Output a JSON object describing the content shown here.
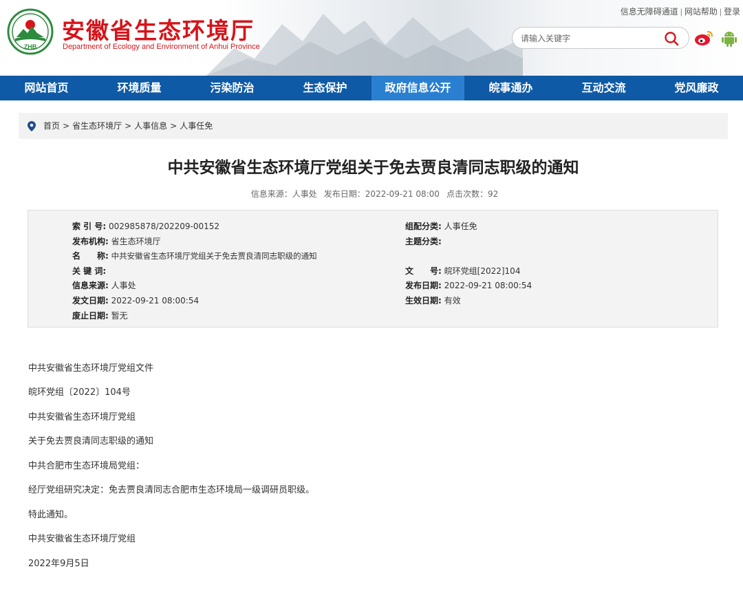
{
  "header": {
    "site_title": "安徽省生态环境厅",
    "site_subtitle": "Department of Ecology and Environment of Anhui Province",
    "logo_text": "ZHB",
    "top_links": [
      "信息无障碍通道",
      "网站帮助",
      "登录"
    ],
    "search_placeholder": "请输入关键字",
    "brand_color": "#d6141a"
  },
  "nav": {
    "items": [
      "网站首页",
      "环境质量",
      "污染防治",
      "生态保护",
      "政府信息公开",
      "皖事通办",
      "互动交流",
      "党风廉政"
    ],
    "active_index": 4,
    "bg_color": "#0e5aa7",
    "active_color": "#2b7fd0"
  },
  "breadcrumb": [
    "首页",
    "省生态环境厅",
    "人事信息",
    "人事任免"
  ],
  "article": {
    "title": "中共安徽省生态环境厅党组关于免去贾良清同志职级的通知",
    "meta_source": "信息来源：人事处",
    "meta_date": "发布日期：2022-09-21 08:00",
    "meta_views": "点击次数：92"
  },
  "info": {
    "index_label": "索 引 号:",
    "index_value": "002985878/202209-00152",
    "category_label": "组配分类:",
    "category_value": "人事任免",
    "publisher_label": "发布机构:",
    "publisher_value": "省生态环境厅",
    "topic_label": "主题分类:",
    "topic_value": "",
    "name_label": "名　　称:",
    "name_value": "中共安徽省生态环境厅党组关于免去贾良清同志职级的通知",
    "keyword_label": "关 键 词:",
    "keyword_value": "",
    "docno_label": "文　　号:",
    "docno_value": "皖环党组[2022]104",
    "source_label": "信息来源:",
    "source_value": "人事处",
    "pubdate_label": "发布日期:",
    "pubdate_value": "2022-09-21 08:00:54",
    "issuedate_label": "发文日期:",
    "issuedate_value": "2022-09-21 08:00:54",
    "effective_label": "生效日期:",
    "effective_value": "有效",
    "expiry_label": "废止日期:",
    "expiry_value": "暂无"
  },
  "body": [
    "中共安徽省生态环境厅党组文件",
    "皖环党组〔2022〕104号",
    "中共安徽省生态环境厅党组",
    "关于免去贾良清同志职级的通知",
    "中共合肥市生态环境局党组：",
    "经厅党组研究决定：免去贾良清同志合肥市生态环境局一级调研员职级。",
    "特此通知。",
    "中共安徽省生态环境厅党组",
    "2022年9月5日"
  ]
}
